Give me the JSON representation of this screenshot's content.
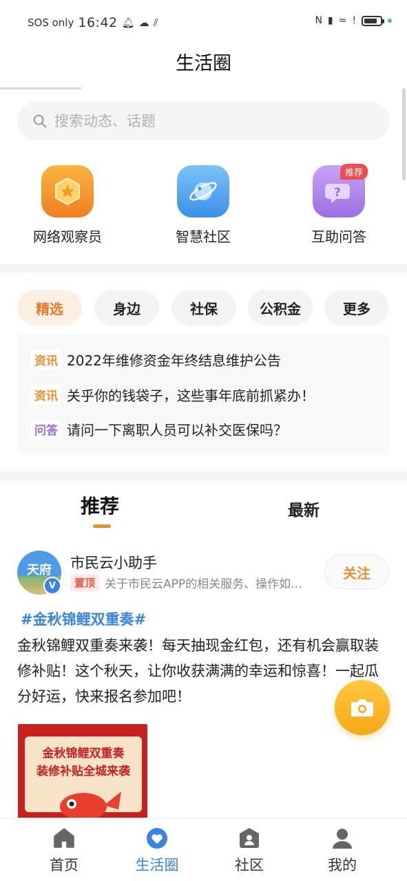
{
  "status_bar": {
    "carrier": "SOS only",
    "time": "16:42",
    "battery_level": 0.75
  },
  "header": {
    "title": "生活圈"
  },
  "search": {
    "placeholder": "搜索动态、话题"
  },
  "quick_entries": [
    {
      "label": "网络观察员",
      "icon": "hexagon-star-icon",
      "color": "#f39a2b"
    },
    {
      "label": "智慧社区",
      "icon": "planet-icon",
      "color": "#4aa3f0"
    },
    {
      "label": "互助问答",
      "icon": "question-bubble-icon",
      "color": "#a77ce8",
      "badge": "推荐"
    }
  ],
  "chips": [
    "精选",
    "身边",
    "社保",
    "公积金",
    "更多"
  ],
  "news": [
    {
      "tag": "资讯",
      "text": "2022年维修资金年终结息维护公告"
    },
    {
      "tag": "资讯",
      "text": "关乎你的钱袋子，这些事年底前抓紧办！"
    },
    {
      "tag": "问答",
      "text": "请问一下离职人员可以补交医保吗？"
    }
  ],
  "feed_tabs": {
    "recommend": "推荐",
    "latest": "最新"
  },
  "post": {
    "avatar_text": "天府",
    "verified": "V",
    "author": "市民云小助手",
    "pin_tag": "置顶",
    "pin_text": "关于市民云APP的相关服务、操作如...",
    "follow_label": "关注",
    "hashtag": "#金秋锦鲤双重奏#",
    "body": "金秋锦鲤双重奏来袭！每天抽现金红包，还有机会赢取装修补贴！这个秋天，让你收获满满的幸运和惊喜！一起瓜分好运，快来报名参加吧！",
    "image_line1": "金秋锦鲤双重奏",
    "image_line2": "装修补贴全城来袭"
  },
  "bottom_nav": [
    {
      "label": "首页",
      "icon": "home-icon"
    },
    {
      "label": "生活圈",
      "icon": "heart-icon",
      "active": true
    },
    {
      "label": "社区",
      "icon": "community-icon"
    },
    {
      "label": "我的",
      "icon": "person-icon"
    }
  ]
}
